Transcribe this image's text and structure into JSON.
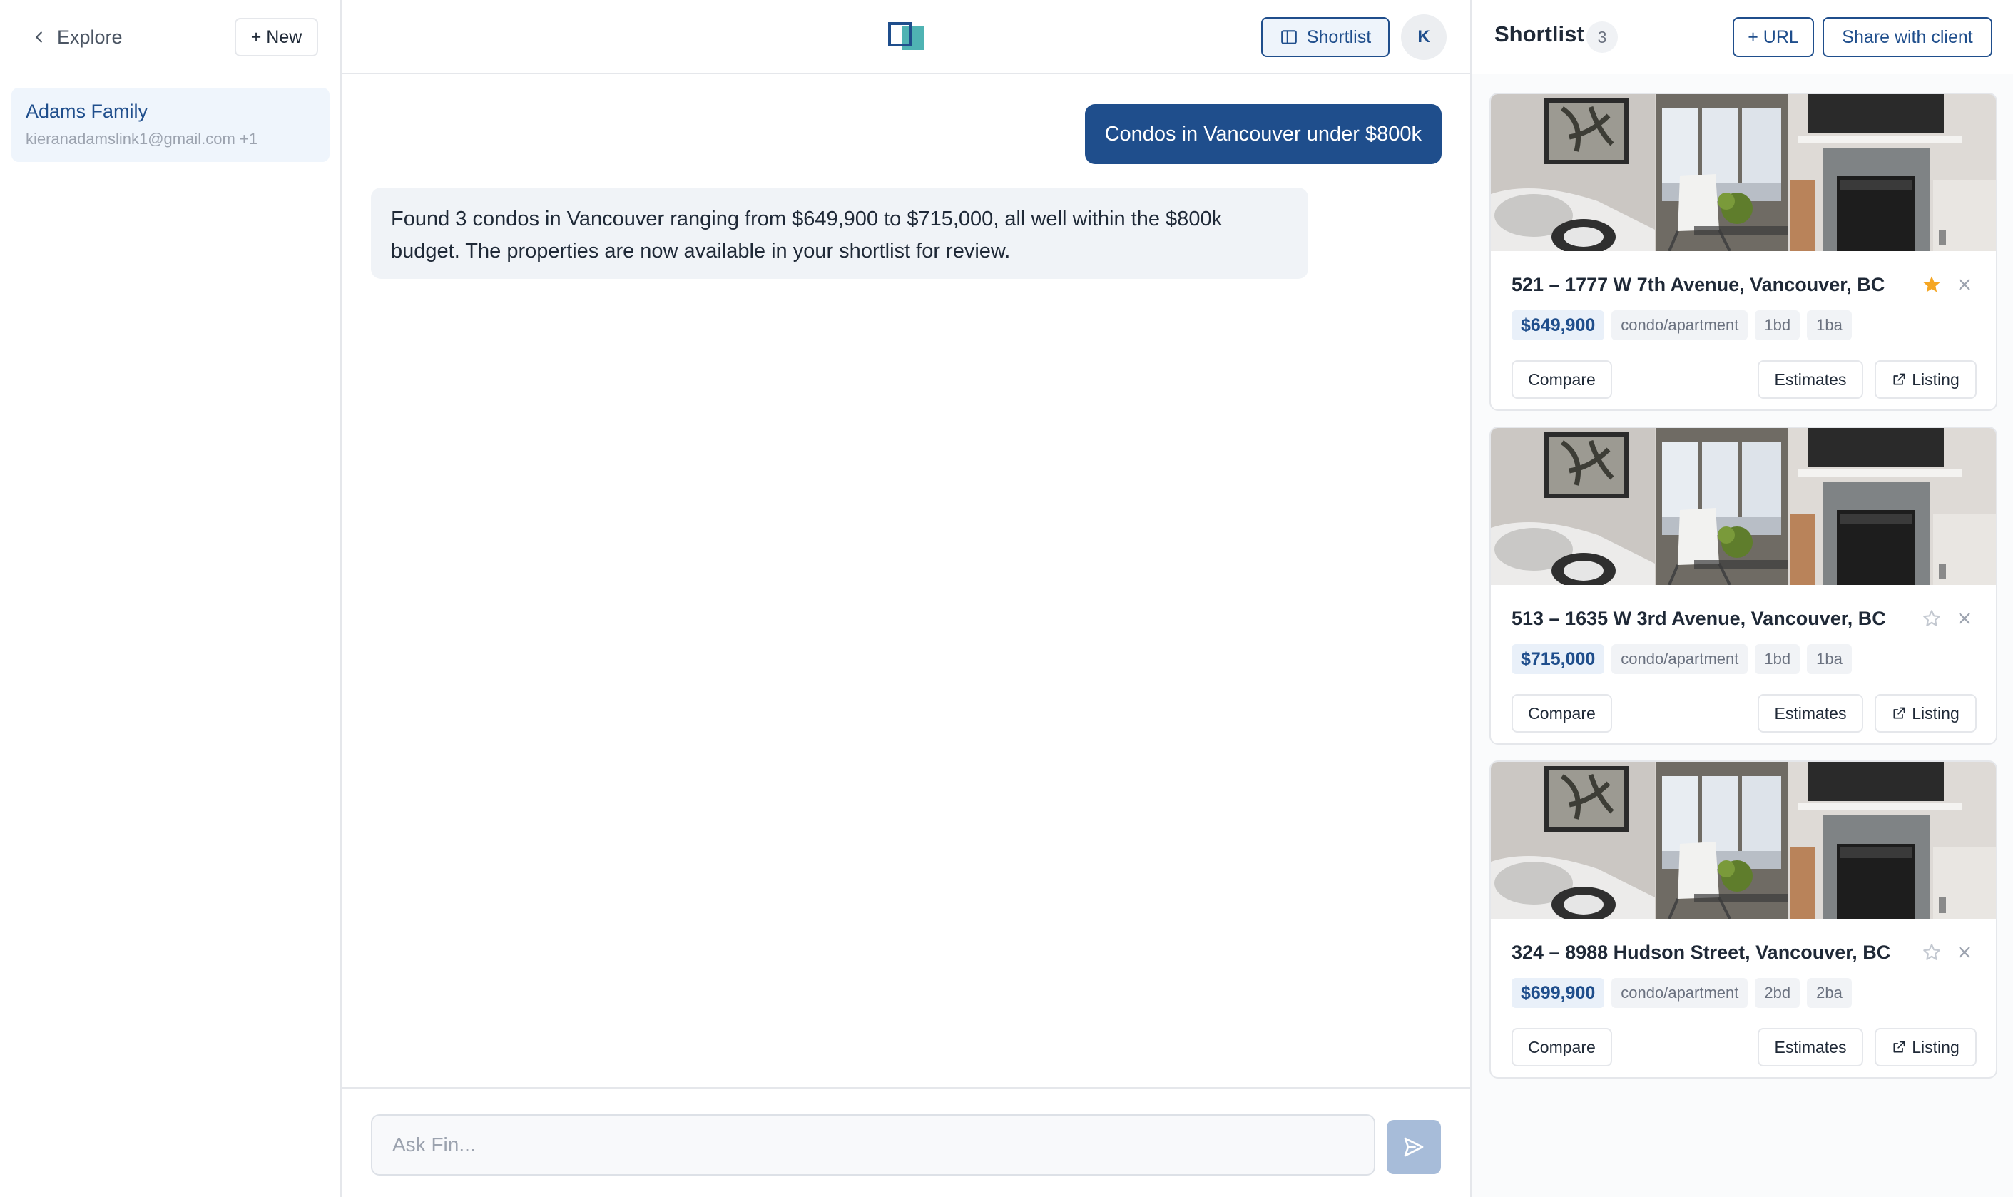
{
  "sidebar": {
    "explore_label": "Explore",
    "new_label": "+ New",
    "clients": [
      {
        "name": "Adams Family",
        "email": "kieranadamslink1@gmail.com +1"
      }
    ]
  },
  "header": {
    "shortlist_label": "Shortlist",
    "avatar_initial": "K"
  },
  "chat": {
    "messages": [
      {
        "role": "user",
        "text": "Condos in Vancouver under $800k"
      },
      {
        "role": "assistant",
        "text": "Found 3 condos in Vancouver ranging from $649,900 to $715,000, all well within the $800k budget. The properties are now available in your shortlist for review."
      }
    ],
    "input_placeholder": "Ask Fin..."
  },
  "shortlist": {
    "title": "Shortlist",
    "count": "3",
    "add_url_label": "+ URL",
    "share_label": "Share with client",
    "compare_label": "Compare",
    "estimates_label": "Estimates",
    "listing_label": "Listing",
    "items": [
      {
        "address": "521 – 1777 W 7th Avenue, Vancouver, BC",
        "price": "$649,900",
        "type": "condo/apartment",
        "beds": "1bd",
        "baths": "1ba",
        "starred": true
      },
      {
        "address": "513 – 1635 W 3rd Avenue, Vancouver, BC",
        "price": "$715,000",
        "type": "condo/apartment",
        "beds": "1bd",
        "baths": "1ba",
        "starred": false
      },
      {
        "address": "324 – 8988 Hudson Street, Vancouver, BC",
        "price": "$699,900",
        "type": "condo/apartment",
        "beds": "2bd",
        "baths": "2ba",
        "starred": false
      }
    ]
  },
  "icons": {
    "back": "chevron-left-icon",
    "panel_toggle": "sidebar-panel-icon",
    "send": "send-icon",
    "star": "star-icon",
    "close": "close-icon",
    "external_link": "external-link-icon"
  },
  "colors": {
    "accent": "#1f4e8c",
    "star_active": "#f5a623",
    "logo_teal": "#4fb3b3",
    "send_disabled": "#a7bcd9"
  }
}
